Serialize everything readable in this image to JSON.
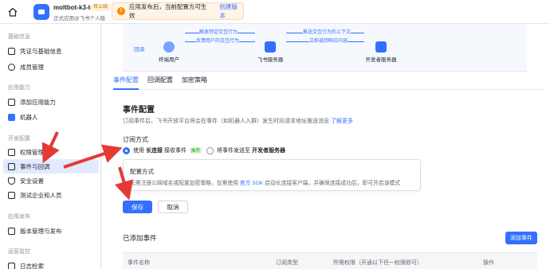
{
  "topbar": {
    "app_name": "moltbot-k3-test",
    "app_badge": "待上线",
    "app_subtitle": "正式应用@飞书个人版",
    "notice_text": "应用发布后，当前配置方可生效",
    "notice_link": "创建版本"
  },
  "sidebar": {
    "group_basic": "基础信息",
    "item_credentials": "凭证与基础信息",
    "item_members": "成员管理",
    "group_capability": "应用能力",
    "item_add_capability": "添加应用能力",
    "item_robot": "机器人",
    "group_dev": "开发配置",
    "item_permissions": "权限管理",
    "item_events": "事件与回调",
    "item_security": "安全设置",
    "item_test": "测试企业和人员",
    "group_release": "应用发布",
    "item_version": "版本管理与发布",
    "group_ops": "运营监控",
    "item_logs": "日志检索"
  },
  "diagram": {
    "tag": "回调",
    "node_user": "终端用户",
    "node_server": "飞书服务器",
    "node_dev": "开发者服务器",
    "arrow_trigger": "触发特定交互行为",
    "arrow_feedback": "反馈用户的交互行为",
    "arrow_push": "推送交互行为的上下文",
    "arrow_return": "立即返回响应内容"
  },
  "tabs": [
    "事件配置",
    "回调配置",
    "加密策略"
  ],
  "event_config": {
    "title": "事件配置",
    "desc": "订阅事件后，飞书开放平台将会在事件（如机器人入群）发生时向请求地址推送消息",
    "desc_link": "了解更多",
    "subscribe_title": "订阅方式",
    "option1_prefix": "使用",
    "option1_bold": "长连接",
    "option1_suffix": "接收事件",
    "option1_tag": "推荐",
    "option2_prefix": "将事件发送至",
    "option2_bold": "开发者服务器",
    "config_title": "配置方式",
    "config_text_a": "无需注册公网域名或配置加密策略，仅需使用",
    "config_text_link": "官方 SDK",
    "config_text_b": "启动长连接客户端，并确保连接成功后，即可开启该模式",
    "save_label": "保存",
    "cancel_label": "取消"
  },
  "added_events": {
    "title": "已添加事件",
    "add_button": "添加事件",
    "columns": [
      "事件名称",
      "订阅类型",
      "所需权限（开通以下任一权限即可）",
      "操作"
    ]
  },
  "colors": {
    "accent": "#3370ff",
    "annotation": "#e53935",
    "active_bg": "#e1eaff"
  }
}
